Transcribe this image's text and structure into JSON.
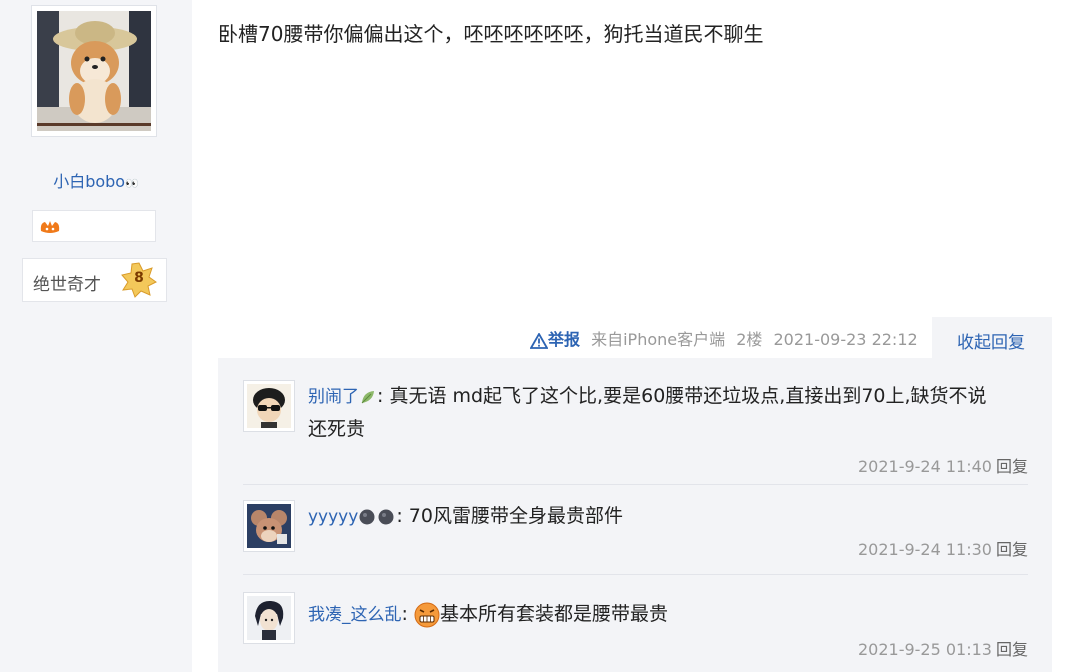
{
  "user": {
    "name": "小白bobo",
    "name_suffix_icon": "eyes-emoji-icon",
    "badge_icon": "orange-badge-icon",
    "level_title": "绝世奇才",
    "level_number": "8",
    "avatar": "shiba-dog-straw-hat-avatar"
  },
  "post": {
    "text": "卧槽70腰带你偏偏出这个，呸呸呸呸呸呸，狗托当道民不聊生"
  },
  "meta": {
    "report_icon": "warning-triangle-icon",
    "report_label": "举报",
    "client": "来自iPhone客户端",
    "floor": "2楼",
    "time": "2021-09-23 22:12",
    "collapse_label": "收起回复"
  },
  "replies": [
    {
      "user": "别闹了",
      "user_icon": "leaf-icon",
      "separator": ":",
      "text_line1": "真无语 md起飞了这个比,要是60腰带还垃圾点,直接出到70上,缺货不说",
      "text_line2": "还死贵",
      "time": "2021-9-24 11:40",
      "reply_label": "回复",
      "avatar": "cartoon-boy-sunglasses-avatar"
    },
    {
      "user": "yyyyy",
      "user_icon": "dark-balls-icon",
      "separator": ":",
      "text": "70风雷腰带全身最贵部件",
      "time": "2021-9-24 11:30",
      "reply_label": "回复",
      "avatar": "cartoon-mouse-avatar"
    },
    {
      "user": "我凑_这么乱",
      "separator": ":",
      "emoji": "grimace-emoji-icon",
      "text": "基本所有套装都是腰带最贵",
      "time": "2021-9-25 01:13",
      "reply_label": "回复",
      "avatar": "anime-character-avatar"
    }
  ],
  "colors": {
    "link": "#2d64b3",
    "meta": "#999999",
    "panel": "#f3f4f7",
    "sidebar": "#f4f5f8"
  }
}
